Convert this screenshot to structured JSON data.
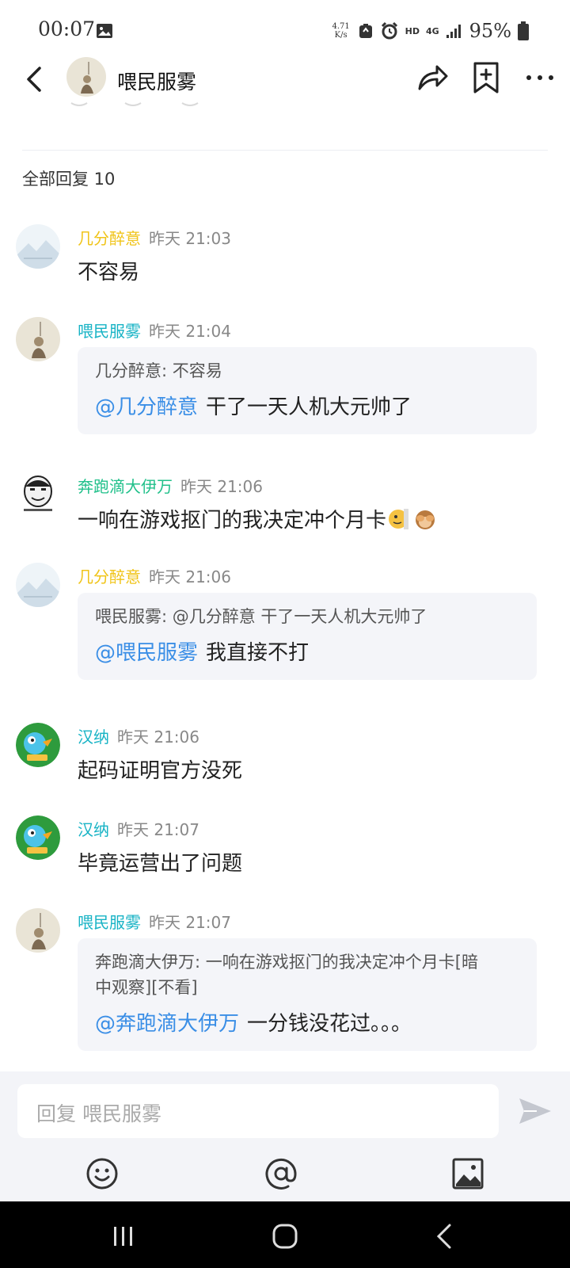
{
  "status_bar": {
    "time": "00:07",
    "net_speed_value": "4.71",
    "net_speed_unit": "K/s",
    "hd_label": "HD",
    "network_label": "4G",
    "battery": "95%"
  },
  "header": {
    "title": "喂民服雾"
  },
  "reply_section": {
    "count_label": "全部回复 10"
  },
  "replies": [
    {
      "name": "几分醉意",
      "time": "昨天 21:03",
      "content": "不容易"
    },
    {
      "name": "喂民服雾",
      "time": "昨天 21:04",
      "quote": "几分醉意: 不容易",
      "mention": "@几分醉意",
      "content": "干了一天人机大元帅了"
    },
    {
      "name": "奔跑滴大伊万",
      "time": "昨天 21:06",
      "content": "一响在游戏抠门的我决定冲个月卡"
    },
    {
      "name": "几分醉意",
      "time": "昨天 21:06",
      "quote": "喂民服雾: @几分醉意 干了一天人机大元帅了",
      "mention": "@喂民服雾",
      "content": "我直接不打"
    },
    {
      "name": "汉纳",
      "time": "昨天 21:06",
      "content": "起码证明官方没死"
    },
    {
      "name": "汉纳",
      "time": "昨天 21:07",
      "content": "毕竟运营出了问题"
    },
    {
      "name": "喂民服雾",
      "time": "昨天 21:07",
      "quote_line1": "奔跑滴大伊万: 一响在游戏抠门的我决定冲个月卡[暗",
      "quote_line2": "中观察][不看]",
      "mention": "@奔跑滴大伊万",
      "content": "一分钱没花过。。。"
    }
  ],
  "composer": {
    "placeholder": "回复 喂民服雾"
  },
  "icons": {
    "back": "back-arrow-icon",
    "share": "share-icon",
    "favorite": "bookmark-add-icon",
    "more": "more-dots-icon",
    "send": "send-icon",
    "emoji": "emoji-icon",
    "mention": "at-icon",
    "image": "image-icon"
  },
  "colors": {
    "name_default": "#17b3c5",
    "name_yellow": "#f0c419",
    "name_green": "#20c08a",
    "mention": "#3a8ee6",
    "quote_bg": "#f4f5f9",
    "panel_bg": "#f3f4f8"
  }
}
